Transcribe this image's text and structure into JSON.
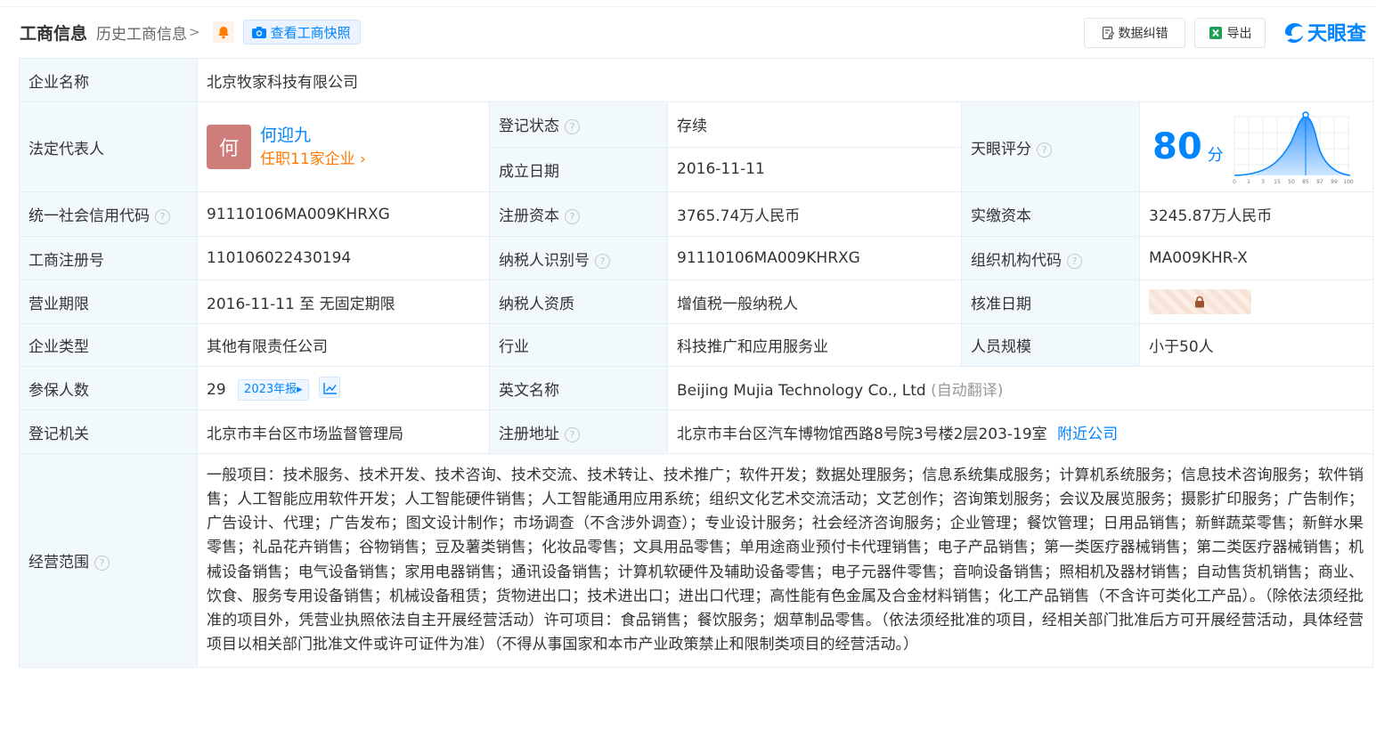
{
  "header": {
    "title": "工商信息",
    "history_link": "历史工商信息",
    "snapshot_button": "查看工商快照",
    "data_correction_button": "数据纠错",
    "export_button": "导出",
    "logo_text": "天眼查"
  },
  "colors": {
    "brand_blue": "#0084ff",
    "label_bg": "#f2f9fc",
    "status_green": "#00a660",
    "highlight_orange": "#ff7a00"
  },
  "table": {
    "company_name_label": "企业名称",
    "company_name": "北京牧家科技有限公司",
    "legal_rep_label": "法定代表人",
    "legal_rep_avatar": "何",
    "legal_rep_name": "何迎九",
    "legal_rep_corps": "任职11家企业",
    "reg_status_label": "登记状态",
    "reg_status": "存续",
    "est_date_label": "成立日期",
    "est_date": "2016-11-11",
    "score_label": "天眼评分",
    "score": "80",
    "score_unit": "分",
    "score_axis": [
      "0",
      "1",
      "3",
      "15",
      "50",
      "85",
      "97",
      "99",
      "100"
    ],
    "credit_code_label": "统一社会信用代码",
    "credit_code": "91110106MA009KHRXG",
    "reg_capital_label": "注册资本",
    "reg_capital": "3765.74万人民币",
    "paid_capital_label": "实缴资本",
    "paid_capital": "3245.87万人民币",
    "biz_reg_no_label": "工商注册号",
    "biz_reg_no": "110106022430194",
    "taxpayer_id_label": "纳税人识别号",
    "taxpayer_id": "91110106MA009KHRXG",
    "org_code_label": "组织机构代码",
    "org_code": "MA009KHR-X",
    "term_label": "营业期限",
    "term": "2016-11-11 至 无固定期限",
    "taxpayer_qual_label": "纳税人资质",
    "taxpayer_qual": "增值税一般纳税人",
    "approval_date_label": "核准日期",
    "company_type_label": "企业类型",
    "company_type": "其他有限责任公司",
    "industry_label": "行业",
    "industry": "科技推广和应用服务业",
    "staff_size_label": "人员规模",
    "staff_size": "小于50人",
    "insured_label": "参保人数",
    "insured": "29",
    "insured_report_tag": "2023年报",
    "english_name_label": "英文名称",
    "english_name": "Beijing Mujia Technology Co., Ltd",
    "english_name_note": "(自动翻译)",
    "reg_authority_label": "登记机关",
    "reg_authority": "北京市丰台区市场监督管理局",
    "reg_address_label": "注册地址",
    "reg_address": "北京市丰台区汽车博物馆西路8号院3号楼2层203-19室",
    "nearby_link": "附近公司",
    "scope_label": "经营范围",
    "scope": "一般项目：技术服务、技术开发、技术咨询、技术交流、技术转让、技术推广；软件开发；数据处理服务；信息系统集成服务；计算机系统服务；信息技术咨询服务；软件销售；人工智能应用软件开发；人工智能硬件销售；人工智能通用应用系统；组织文化艺术交流活动；文艺创作；咨询策划服务；会议及展览服务；摄影扩印服务；广告制作；广告设计、代理；广告发布；图文设计制作；市场调查（不含涉外调查）；专业设计服务；社会经济咨询服务；企业管理；餐饮管理；日用品销售；新鲜蔬菜零售；新鲜水果零售；礼品花卉销售；谷物销售；豆及薯类销售；化妆品零售；文具用品零售；单用途商业预付卡代理销售；电子产品销售；第一类医疗器械销售；第二类医疗器械销售；机械设备销售；电气设备销售；家用电器销售；通讯设备销售；计算机软硬件及辅助设备零售；电子元器件零售；音响设备销售；照相机及器材销售；自动售货机销售；商业、饮食、服务专用设备销售；机械设备租赁；货物进出口；技术进出口；进出口代理；高性能有色金属及合金材料销售；化工产品销售（不含许可类化工产品）。（除依法须经批准的项目外，凭营业执照依法自主开展经营活动）许可项目：食品销售；餐饮服务；烟草制品零售。（依法须经批准的项目，经相关部门批准后方可开展经营活动，具体经营项目以相关部门批准文件或许可证件为准）（不得从事国家和本市产业政策禁止和限制类项目的经营活动。）"
  }
}
